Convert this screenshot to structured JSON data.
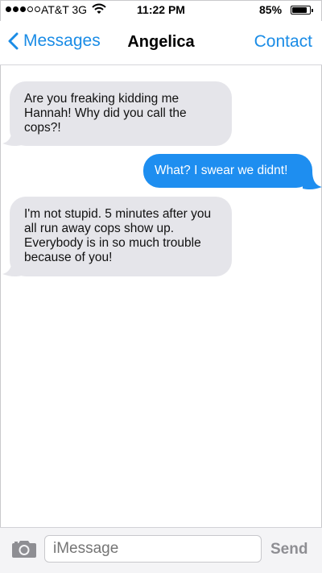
{
  "status_bar": {
    "carrier": "AT&T",
    "network": "3G",
    "time": "11:22 PM",
    "battery_percent": "85%",
    "battery_level": 0.85,
    "signal_bars": 3,
    "signal_total": 5
  },
  "nav": {
    "back_label": "Messages",
    "title": "Angelica",
    "contact_label": "Contact"
  },
  "messages": [
    {
      "direction": "incoming",
      "text": "Are you freaking kidding me Hannah! Why did you call the cops?!"
    },
    {
      "direction": "outgoing",
      "text": "What? I swear we didnt!"
    },
    {
      "direction": "incoming",
      "text": "I'm not stupid. 5 minutes after you all run away cops show up. Everybody is in so much trouble because of you!"
    }
  ],
  "input": {
    "placeholder": "iMessage",
    "send_label": "Send"
  },
  "colors": {
    "accent": "#1a8ce6",
    "outgoing_bubble": "#1e8ef0",
    "incoming_bubble": "#e5e5ea"
  },
  "icons": [
    "signal-dots-icon",
    "wifi-icon",
    "battery-icon",
    "chevron-left-icon",
    "camera-icon"
  ]
}
